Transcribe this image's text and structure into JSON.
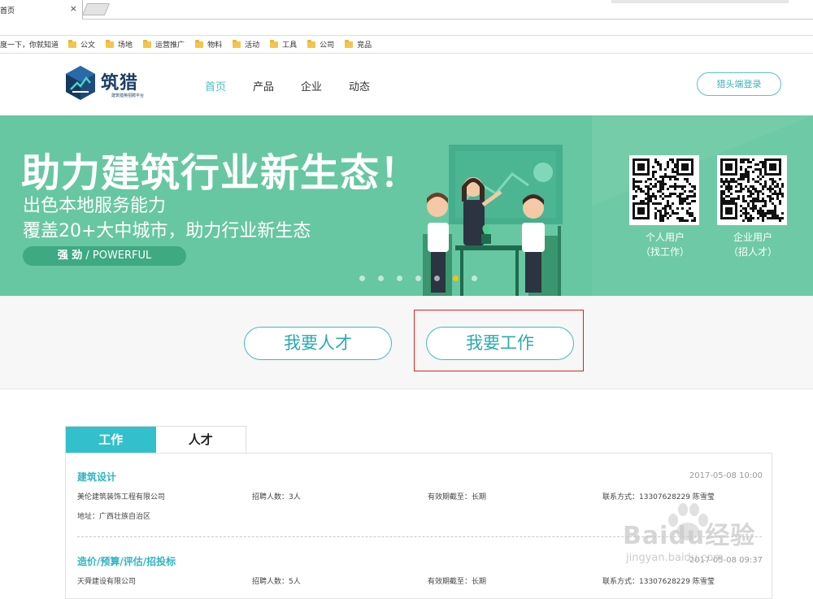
{
  "browser": {
    "tab_title": "首页",
    "tab_close": "×",
    "bookmarks": [
      "度一下，你就知道",
      "公文",
      "场地",
      "运营推广",
      "物料",
      "活动",
      "工具",
      "公司",
      "竞品"
    ]
  },
  "header": {
    "logo_text": "筑猎",
    "logo_sub": "建筑猎英招聘平台",
    "nav": [
      "首页",
      "产品",
      "企业",
      "动态"
    ],
    "login_label": "猎头端登录"
  },
  "banner": {
    "headline": "助力建筑行业新生态！",
    "line1": "出色本地服务能力",
    "line2": "覆盖20+大中城市，助力行业新生态",
    "badge_strong": "强 劲",
    "badge_rest": " / POWERFUL",
    "dots_count": 7,
    "active_dot": 5,
    "qr_personal_label_1": "个人用户",
    "qr_personal_label_2": "（找工作）",
    "qr_company_label_1": "企业用户",
    "qr_company_label_2": "（招人才）"
  },
  "cta": {
    "talent": "我要人才",
    "job": "我要工作"
  },
  "listing": {
    "tabs": [
      "工作",
      "人才"
    ],
    "jobs": [
      {
        "title": "建筑设计",
        "time": "2017-05-08 10:00",
        "company": "美伦建筑装饰工程有限公司",
        "headcount": "招聘人数：3人",
        "validity": "有效期截至：长期",
        "contact": "联系方式：13307628229 陈雪莹",
        "address": "地址：广西壮族自治区"
      },
      {
        "title": "造价/预算/评估/招投标",
        "time": "2017-05-08 09:37",
        "company": "天舜建设有限公司",
        "headcount": "招聘人数：5人",
        "validity": "有效期截至：长期",
        "contact": "联系方式：13307628229 陈雪莹"
      }
    ]
  },
  "watermark": {
    "text": "Baidu经验",
    "url": "jingyan.baidu.com"
  }
}
